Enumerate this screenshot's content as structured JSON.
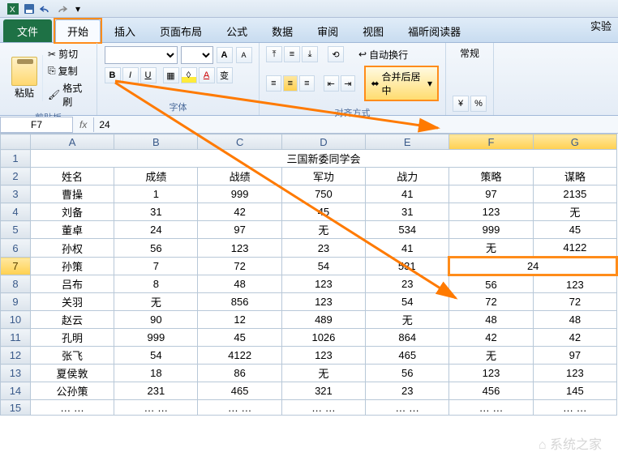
{
  "qat": {
    "save_tip": "保存",
    "undo_tip": "撤销",
    "redo_tip": "重做"
  },
  "experiment_label": "实验",
  "tabs": {
    "file": "文件",
    "home": "开始",
    "insert": "插入",
    "layout": "页面布局",
    "formulas": "公式",
    "data": "数据",
    "review": "审阅",
    "view": "视图",
    "foxit": "福昕阅读器"
  },
  "clipboard": {
    "paste": "粘贴",
    "cut": "剪切",
    "copy": "复制",
    "format_painter": "格式刷",
    "group_label": "剪贴板"
  },
  "font": {
    "group_label": "字体",
    "grow": "A",
    "shrink": "A"
  },
  "align": {
    "group_label": "对齐方式",
    "wrap_text": "自动换行",
    "merge_center": "合并后居中"
  },
  "number": {
    "general": "常规"
  },
  "name_box": "F7",
  "formula_value": "24",
  "columns": [
    "A",
    "B",
    "C",
    "D",
    "E",
    "F",
    "G"
  ],
  "title_row": "三国新委同学会",
  "headers": [
    "姓名",
    "成绩",
    "战绩",
    "军功",
    "战力",
    "策略",
    "谋略"
  ],
  "rows": [
    [
      "曹操",
      "1",
      "999",
      "750",
      "41",
      "97",
      "2135"
    ],
    [
      "刘备",
      "31",
      "42",
      "45",
      "31",
      "123",
      "无"
    ],
    [
      "董卓",
      "24",
      "97",
      "无",
      "534",
      "999",
      "45"
    ],
    [
      "孙权",
      "56",
      "123",
      "23",
      "41",
      "无",
      "4122"
    ],
    [
      "孙策",
      "7",
      "72",
      "54",
      "531",
      "24",
      ""
    ],
    [
      "吕布",
      "8",
      "48",
      "123",
      "23",
      "56",
      "123"
    ],
    [
      "关羽",
      "无",
      "856",
      "123",
      "54",
      "72",
      "72"
    ],
    [
      "赵云",
      "90",
      "12",
      "489",
      "无",
      "48",
      "48"
    ],
    [
      "孔明",
      "999",
      "45",
      "1026",
      "864",
      "42",
      "42"
    ],
    [
      "张飞",
      "54",
      "4122",
      "123",
      "465",
      "无",
      "97"
    ],
    [
      "夏侯敦",
      "18",
      "86",
      "无",
      "56",
      "123",
      "123"
    ],
    [
      "公孙策",
      "231",
      "465",
      "321",
      "23",
      "456",
      "145"
    ],
    [
      "…  …",
      "…  …",
      "…  …",
      "…  …",
      "…  …",
      "…  …",
      "…  …"
    ]
  ],
  "merged_value": "24",
  "watermark": "系统之家"
}
